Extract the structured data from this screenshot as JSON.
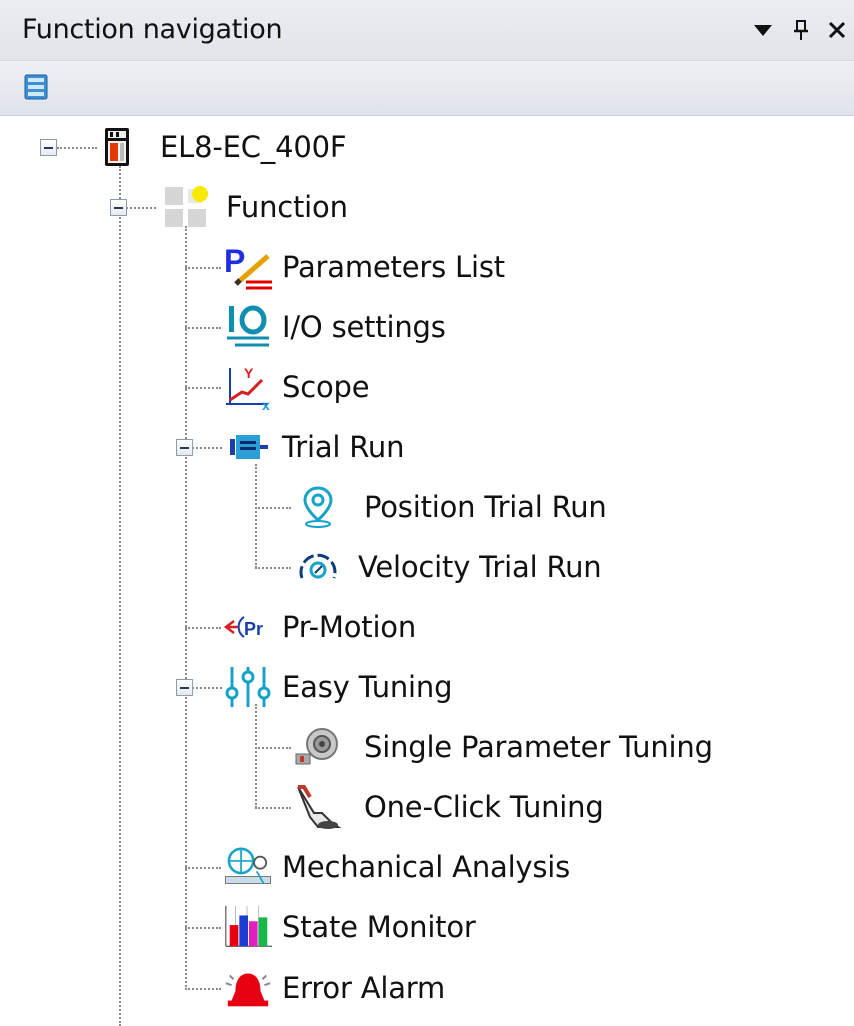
{
  "panel": {
    "title": "Function navigation",
    "buttons": {
      "dropdown_icon": "dropdown-arrow-icon",
      "pin_icon": "pin-icon",
      "close_icon": "close-icon"
    }
  },
  "toolbar": {
    "view_icon": "tree-view-icon"
  },
  "tree": {
    "root": {
      "label": "EL8-EC_400F",
      "icon": "servo-drive-icon",
      "expanded": true
    },
    "function": {
      "label": "Function",
      "icon": "function-group-icon",
      "expanded": true
    },
    "items": {
      "parameters_list": {
        "label": "Parameters List",
        "icon": "parameters-icon"
      },
      "io_settings": {
        "label": "I/O settings",
        "icon": "io-icon"
      },
      "scope": {
        "label": "Scope",
        "icon": "scope-icon"
      },
      "trial_run": {
        "label": "Trial Run",
        "icon": "motor-icon",
        "expanded": true
      },
      "position_trial_run": {
        "label": "Position Trial Run",
        "icon": "position-pin-icon"
      },
      "velocity_trial_run": {
        "label": "Velocity Trial Run",
        "icon": "speedometer-icon"
      },
      "pr_motion": {
        "label": "Pr-Motion",
        "icon": "pr-motion-icon"
      },
      "easy_tuning": {
        "label": "Easy Tuning",
        "icon": "sliders-icon",
        "expanded": true
      },
      "single_parameter_tuning": {
        "label": "Single Parameter Tuning",
        "icon": "turbo-icon"
      },
      "one_click_tuning": {
        "label": "One-Click Tuning",
        "icon": "hand-click-icon"
      },
      "mechanical_analysis": {
        "label": "Mechanical Analysis",
        "icon": "mechanical-analysis-icon"
      },
      "state_monitor": {
        "label": "State Monitor",
        "icon": "bar-chart-icon"
      },
      "error_alarm": {
        "label": "Error Alarm",
        "icon": "alarm-bell-icon"
      }
    }
  },
  "colors": {
    "titlebar": "#e6e9ee",
    "connector": "#8a8a8a",
    "accent_blue": "#1565c0",
    "accent_cyan": "#17a2c8",
    "alarm_red": "#e60012"
  }
}
